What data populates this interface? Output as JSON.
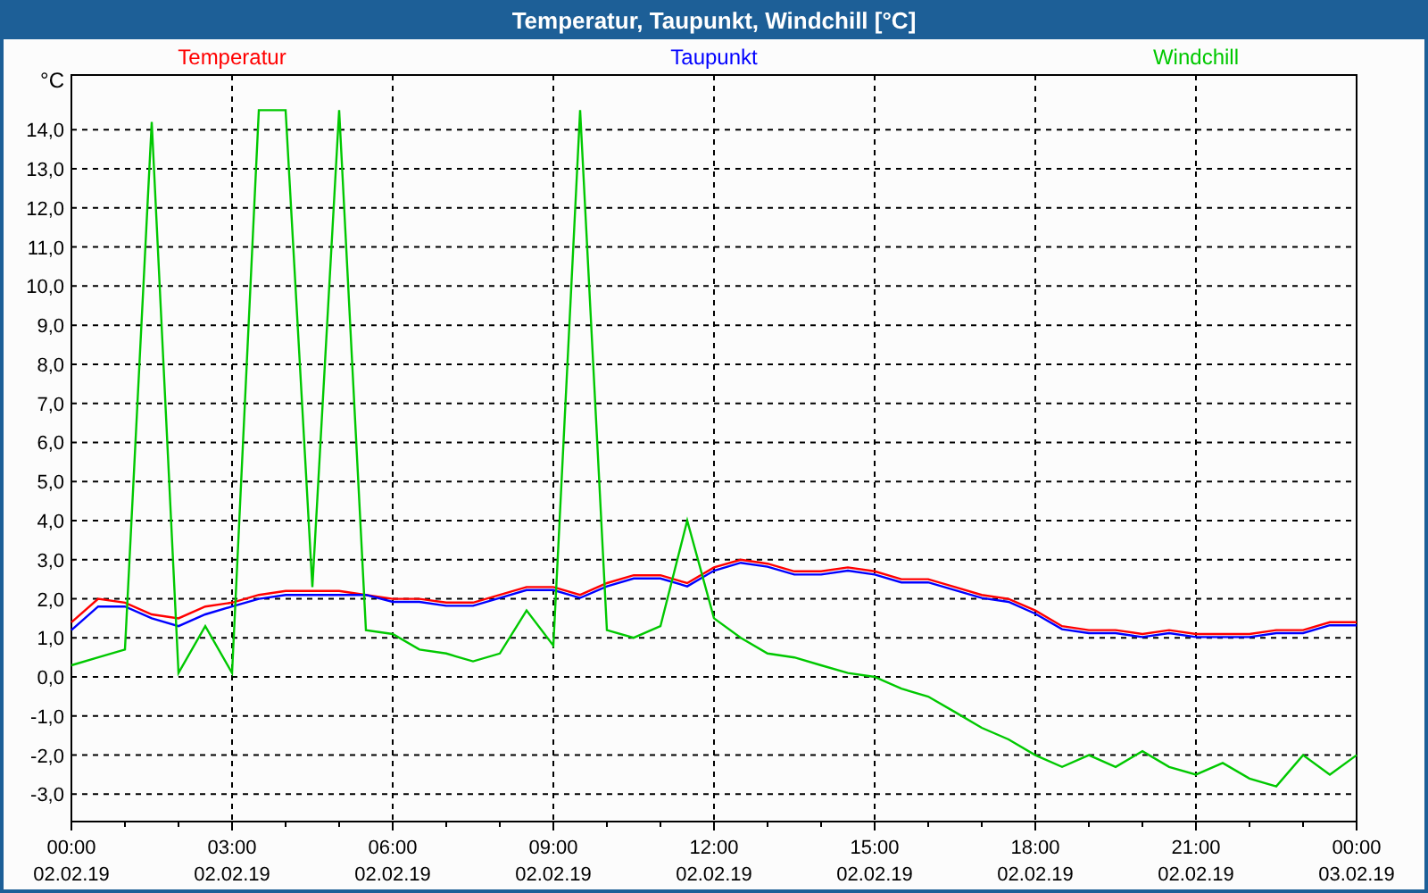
{
  "window": {
    "title": "Temperatur, Taupunkt, Windchill [°C]"
  },
  "chart": {
    "chart_data": {
      "type": "line",
      "ylabel": "°C",
      "grid": true,
      "ylim": [
        -3.7,
        15.4
      ],
      "categories": [
        "00:00 02.02.19",
        null,
        null,
        null,
        null,
        null,
        "03:00 02.02.19",
        null,
        null,
        null,
        null,
        null,
        "06:00 02.02.19",
        null,
        null,
        null,
        null,
        null,
        "09:00 02.02.19",
        null,
        null,
        null,
        null,
        null,
        "12:00 02.02.19",
        null,
        null,
        null,
        null,
        null,
        "15:00 02.02.19",
        null,
        null,
        null,
        null,
        null,
        "18:00 02.02.19",
        null,
        null,
        null,
        null,
        null,
        "21:00 02.02.19",
        null,
        null,
        null,
        null,
        null,
        "00:00 03.02.19"
      ],
      "yticks": [
        {
          "value": -3,
          "label": "-3,0"
        },
        {
          "value": -2,
          "label": "-2,0"
        },
        {
          "value": -1,
          "label": "-1,0"
        },
        {
          "value": 0,
          "label": "0,0"
        },
        {
          "value": 1,
          "label": "1,0"
        },
        {
          "value": 2,
          "label": "2,0"
        },
        {
          "value": 3,
          "label": "3,0"
        },
        {
          "value": 4,
          "label": "4,0"
        },
        {
          "value": 5,
          "label": "5,0"
        },
        {
          "value": 6,
          "label": "6,0"
        },
        {
          "value": 7,
          "label": "7,0"
        },
        {
          "value": 8,
          "label": "8,0"
        },
        {
          "value": 9,
          "label": "9,0"
        },
        {
          "value": 10,
          "label": "10,0"
        },
        {
          "value": 11,
          "label": "11,0"
        },
        {
          "value": 12,
          "label": "12,0"
        },
        {
          "value": 13,
          "label": "13,0"
        },
        {
          "value": 14,
          "label": "14,0"
        }
      ],
      "series": [
        {
          "name": "Temperatur",
          "color": "#ff0000",
          "values": [
            1.4,
            2.0,
            1.9,
            1.6,
            1.5,
            1.8,
            1.9,
            2.1,
            2.2,
            2.2,
            2.2,
            2.1,
            2.0,
            2.0,
            1.9,
            1.9,
            2.1,
            2.3,
            2.3,
            2.1,
            2.4,
            2.6,
            2.6,
            2.4,
            2.8,
            3.0,
            2.9,
            2.7,
            2.7,
            2.8,
            2.7,
            2.5,
            2.5,
            2.3,
            2.1,
            2.0,
            1.7,
            1.3,
            1.2,
            1.2,
            1.1,
            1.2,
            1.1,
            1.1,
            1.1,
            1.2,
            1.2,
            1.4,
            1.4
          ]
        },
        {
          "name": "Taupunkt",
          "color": "#0000ff",
          "values": [
            1.2,
            1.8,
            1.8,
            1.5,
            1.3,
            1.6,
            1.8,
            2.0,
            2.1,
            2.1,
            2.1,
            2.1,
            1.92,
            1.92,
            1.82,
            1.82,
            2.02,
            2.22,
            2.22,
            2.02,
            2.32,
            2.52,
            2.52,
            2.32,
            2.72,
            2.92,
            2.82,
            2.62,
            2.62,
            2.72,
            2.62,
            2.42,
            2.42,
            2.22,
            2.02,
            1.92,
            1.62,
            1.22,
            1.12,
            1.12,
            1.02,
            1.12,
            1.02,
            1.02,
            1.02,
            1.12,
            1.12,
            1.32,
            1.32
          ]
        },
        {
          "name": "Windchill",
          "color": "#00c800",
          "values": [
            0.3,
            0.5,
            0.7,
            14.2,
            0.1,
            1.3,
            0.1,
            14.5,
            14.5,
            2.3,
            14.5,
            1.2,
            1.1,
            0.7,
            0.6,
            0.4,
            0.6,
            1.7,
            0.8,
            14.5,
            1.2,
            1.0,
            1.3,
            4.0,
            1.5,
            1.0,
            0.6,
            0.5,
            0.3,
            0.1,
            0.0,
            -0.3,
            -0.5,
            -0.9,
            -1.3,
            -1.6,
            -2.0,
            -2.3,
            -2.0,
            -2.3,
            -1.9,
            -2.3,
            -2.5,
            -2.2,
            -2.6,
            -2.8,
            -2.0,
            -2.5,
            -2.0
          ]
        }
      ]
    }
  }
}
